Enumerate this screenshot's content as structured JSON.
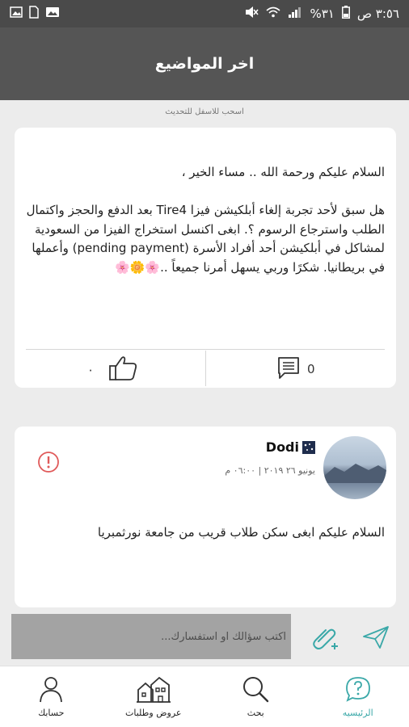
{
  "status_bar": {
    "time": "٣:٥٦ ص",
    "battery": "%٣١",
    "colors": {
      "background": "#4a4a4a"
    }
  },
  "app_bar": {
    "title": "اخر المواضيع"
  },
  "pull_hint": "اسحب للاسفل للتحديث",
  "post1": {
    "text": "السلام عليكم ورحمة الله .. مساء الخير ،\n\nهل سبق لأحد تجربة إلغاء أبلكيشن فيزا Tire4 بعد الدفع والحجز واكتمال الطلب  واسترجاع الرسوم ؟.   ابغى اكنسل استخراج الفيزا من السعودية لمشاكل في أبلكيشن أحد أفراد الأسرة (pending payment)  وأعملها في بريطانيا.   شكرًا وربي يسهل أمرنا جميعاً ..🌸🌼🌸",
    "likes": "٠",
    "comments": "0"
  },
  "post2": {
    "user_name": "Dodi",
    "date": "يونيو ٢٦ ٢٠١٩ | ٠٦:٠٠ م",
    "text": "السلام عليكم ابغى سكن طلاب قريب من جامعة نورثمبريا"
  },
  "composer": {
    "placeholder": "اكتب سؤالك او استفسارك..."
  },
  "bottom_nav": {
    "items": [
      {
        "label": "حسابك",
        "icon": "person-icon"
      },
      {
        "label": "عروض وطلبات",
        "icon": "houses-icon"
      },
      {
        "label": "بحث",
        "icon": "search-icon"
      },
      {
        "label": "الرئيسيه",
        "icon": "question-bubble-icon",
        "active": true
      }
    ]
  },
  "colors": {
    "accent": "#3aa8a8",
    "app_bar": "#555555",
    "report": "#e05a5a",
    "input": "#a3a3a3"
  }
}
